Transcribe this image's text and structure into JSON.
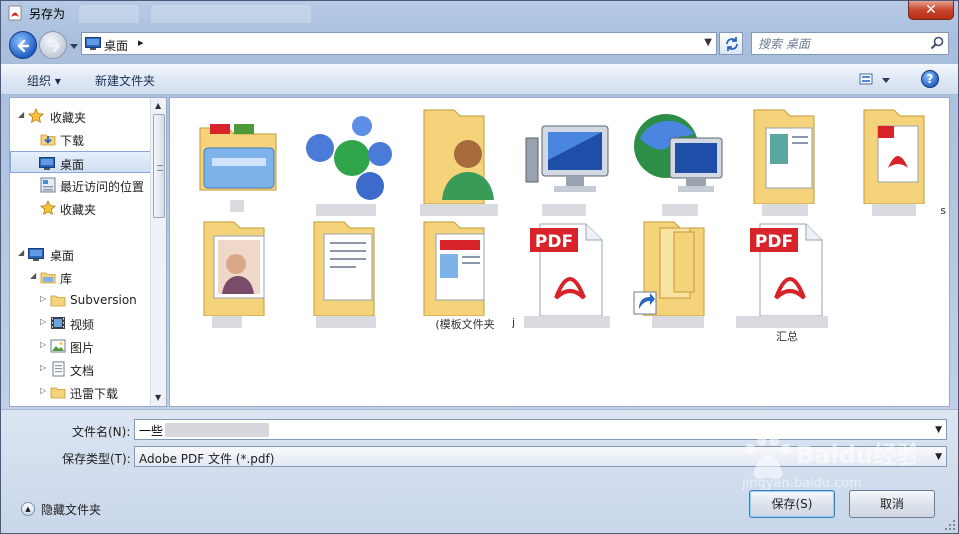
{
  "window": {
    "title": "另存为",
    "close_symbol": "✕"
  },
  "address": {
    "crumb": "桌面",
    "search_placeholder": "搜索 桌面"
  },
  "toolbar": {
    "organize": "组织 ▾",
    "new_folder": "新建文件夹",
    "help": "?"
  },
  "sidebar": {
    "items": [
      {
        "label": "收藏夹",
        "icon": "star-icon",
        "level": 0,
        "expanded": true
      },
      {
        "label": "下载",
        "icon": "download-folder-icon",
        "level": 1
      },
      {
        "label": "桌面",
        "icon": "desktop-icon",
        "level": 1,
        "selected": true
      },
      {
        "label": "最近访问的位置",
        "icon": "recent-places-icon",
        "level": 1
      },
      {
        "label": "收藏夹",
        "icon": "star-icon",
        "level": 1
      },
      {
        "label": "桌面",
        "icon": "desktop-icon",
        "level": 0,
        "expanded": true
      },
      {
        "label": "库",
        "icon": "library-icon",
        "level": 1,
        "expanded": true
      },
      {
        "label": "Subversion",
        "icon": "folder-icon",
        "level": 2
      },
      {
        "label": "视频",
        "icon": "video-library-icon",
        "level": 2
      },
      {
        "label": "图片",
        "icon": "picture-library-icon",
        "level": 2
      },
      {
        "label": "文档",
        "icon": "document-library-icon",
        "level": 2
      },
      {
        "label": "迅雷下载",
        "icon": "folder-icon",
        "level": 2
      }
    ]
  },
  "content": {
    "tiles": [
      {
        "icon": "libraries-folder-icon",
        "caption": ""
      },
      {
        "icon": "homegroup-icon",
        "caption": ""
      },
      {
        "icon": "user-folder-icon",
        "caption": ""
      },
      {
        "icon": "computer-icon",
        "caption": ""
      },
      {
        "icon": "network-icon",
        "caption": ""
      },
      {
        "icon": "folder-with-documents-icon",
        "caption": ""
      },
      {
        "icon": "folder-with-pdf-icon",
        "caption": "s"
      },
      {
        "icon": "folder-with-photos-icon",
        "caption": ""
      },
      {
        "icon": "folder-with-papers-icon",
        "caption": ""
      },
      {
        "icon": "folder-with-screenshots-icon",
        "caption": "(模板文件夹"
      },
      {
        "icon": "pdf-file-icon",
        "caption": "j"
      },
      {
        "icon": "folder-shortcut-icon",
        "caption": ""
      },
      {
        "icon": "pdf-file-icon",
        "caption": "汇总"
      }
    ],
    "pdf_label": "PDF"
  },
  "form": {
    "filename_label": "文件名(N):",
    "filename_value": "一些",
    "filetype_label": "保存类型(T):",
    "filetype_value": "Adobe PDF 文件 (*.pdf)",
    "hide_folders": "隐藏文件夹",
    "save_button": "保存(S)",
    "cancel_button": "取消"
  },
  "watermark": {
    "text": "Baidu经验",
    "url_text": "jingyan.baidu.com"
  },
  "colors": {
    "title_bar": "#b7cbe6",
    "close_red": "#c8442c",
    "selection": "#cfdef3",
    "pdf_red": "#d8232a",
    "folder_yellow": "#f4d37a"
  }
}
